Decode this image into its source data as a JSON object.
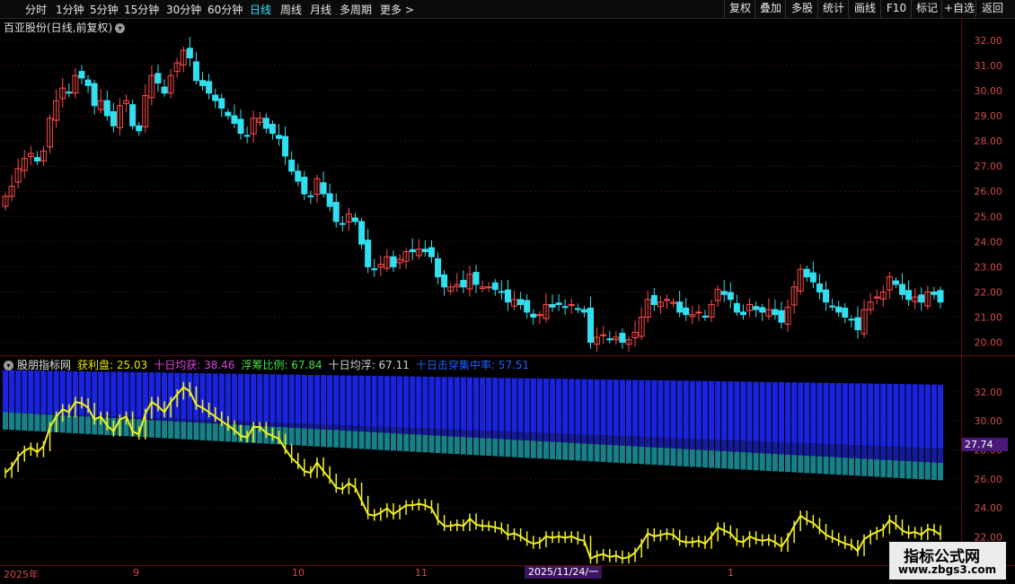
{
  "toolbar": {
    "periods": [
      "分时",
      "1分钟",
      "5分钟",
      "15分钟",
      "30分钟",
      "60分钟",
      "日线",
      "周线",
      "月线",
      "多周期",
      "更多 >"
    ],
    "active_index": 6,
    "right_buttons": [
      "复权",
      "叠加",
      "多股",
      "统计",
      "画线",
      "F10",
      "标记",
      "+自选",
      "返回"
    ]
  },
  "chart_title": "百亚股份(日线,前复权)",
  "main_axis": {
    "ticks": [
      "32.00",
      "31.00",
      "30.00",
      "29.00",
      "28.00",
      "27.00",
      "26.00",
      "25.00",
      "24.00",
      "23.00",
      "22.00",
      "21.00",
      "20.00"
    ]
  },
  "indicator": {
    "name": "股朋指标网",
    "items": [
      {
        "label": "获利盘",
        "value": "25.03",
        "color": "#e6e600"
      },
      {
        "label": "十日均获",
        "value": "38.46",
        "color": "#e040e0"
      },
      {
        "label": "浮筹比例",
        "value": "67.84",
        "color": "#40e040"
      },
      {
        "label": "十日均浮",
        "value": "67.11",
        "color": "#d0d0d0"
      },
      {
        "label": "十日击穿集中率",
        "value": "57.51",
        "color": "#2060ff"
      }
    ],
    "axis_ticks": [
      "32.00",
      "30.00",
      "28.00",
      "26.00",
      "24.00",
      "22.00"
    ],
    "current_price": "27.74"
  },
  "date_labels": [
    "2025年",
    "9",
    "10",
    "11",
    "1"
  ],
  "cross_date": "2025/11/24/一",
  "watermark": {
    "line1": "指标公式网",
    "line2": "www.zbgs3.com"
  },
  "colors": {
    "up": "#ff4a4a",
    "down": "#30e0f0",
    "yellow": "#f0f020",
    "bg": "#000000"
  },
  "chart_data": {
    "type": "candlestick",
    "y_range": [
      19.7,
      32.6
    ],
    "closes": [
      25.8,
      26.2,
      26.9,
      27.3,
      27.5,
      27.2,
      27.6,
      28.9,
      29.6,
      30.1,
      29.9,
      30.6,
      30.5,
      30.2,
      29.4,
      29.6,
      29.0,
      28.6,
      29.4,
      29.6,
      28.6,
      28.4,
      29.8,
      30.6,
      30.3,
      29.9,
      30.6,
      31.1,
      31.6,
      31.3,
      30.4,
      30.2,
      29.9,
      29.6,
      29.3,
      29.0,
      28.7,
      28.3,
      28.2,
      28.9,
      28.9,
      28.5,
      28.3,
      28.1,
      27.4,
      26.8,
      26.4,
      25.9,
      25.8,
      26.5,
      25.9,
      25.4,
      24.8,
      24.7,
      25.1,
      24.8,
      23.9,
      23.0,
      22.9,
      23.1,
      23.4,
      23.0,
      23.3,
      23.6,
      23.6,
      23.7,
      23.6,
      23.4,
      22.6,
      22.2,
      22.2,
      22.3,
      22.2,
      22.7,
      22.3,
      22.2,
      22.2,
      22.1,
      22.0,
      21.6,
      21.7,
      21.5,
      21.2,
      21.0,
      21.1,
      21.5,
      21.4,
      21.5,
      21.4,
      21.5,
      21.3,
      21.2,
      20.0,
      20.2,
      20.3,
      20.1,
      20.2,
      20.0,
      20.1,
      20.4,
      21.0,
      21.7,
      21.5,
      21.6,
      21.7,
      21.6,
      21.2,
      21.1,
      21.1,
      21.2,
      21.0,
      21.5,
      22.1,
      21.9,
      21.7,
      21.2,
      21.1,
      21.5,
      21.3,
      21.2,
      21.3,
      21.1,
      20.8,
      21.4,
      22.2,
      22.9,
      22.6,
      22.4,
      22.0,
      21.6,
      21.4,
      21.2,
      21.0,
      20.9,
      20.5,
      21.3,
      21.6,
      21.8,
      22.0,
      22.6,
      22.3,
      21.9,
      21.7,
      21.8,
      21.6,
      22.0,
      21.9,
      21.6
    ]
  }
}
